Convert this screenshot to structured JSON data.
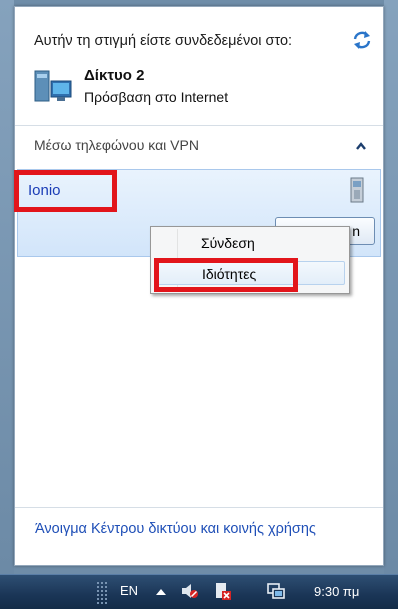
{
  "header": {
    "title": "Αυτήν τη στιγμή είστε συνδεδεμένοι στο:",
    "refresh_icon": "refresh-icon"
  },
  "current_network": {
    "name": "Δίκτυο 2",
    "status": "Πρόσβαση στο Internet",
    "icon": "network-icon"
  },
  "section": {
    "title": "Μέσω τηλεφώνου και VPN",
    "collapse_icon": "chevron-up-icon"
  },
  "connection": {
    "name": "Ionio",
    "button_label": "n",
    "icon": "vpn-icon"
  },
  "context_menu": {
    "items": [
      {
        "label": "Σύνδεση"
      },
      {
        "label": "Ιδιότητες"
      }
    ]
  },
  "footer": {
    "link": "Άνοιγμα Κέντρου δικτύου και κοινής χρήσης"
  },
  "taskbar": {
    "language": "EN",
    "clock": "9:30 πμ",
    "tray_icons": [
      "show-hidden-icons-arrow",
      "volume-muted-icon",
      "action-center-alert-icon",
      "network-icon"
    ]
  },
  "colors": {
    "highlight": "#e2151b",
    "link": "#1f4fb7",
    "connection_name": "#1a3cb6"
  }
}
